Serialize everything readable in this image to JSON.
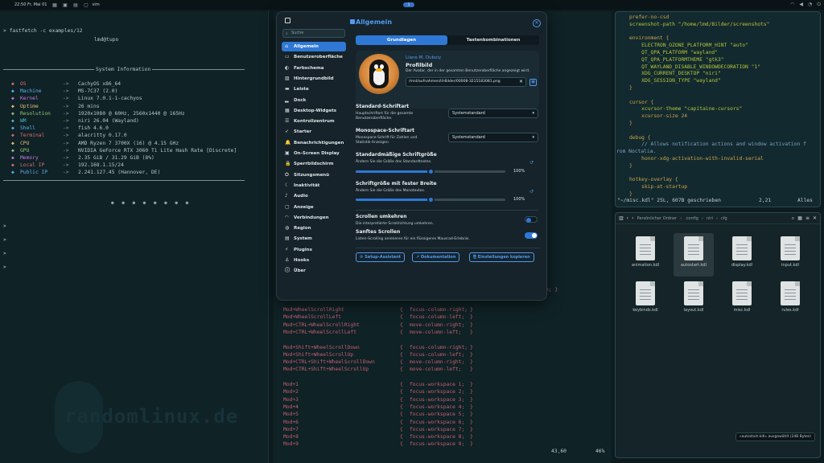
{
  "topbar": {
    "clock": "22:50 Fr, Mai 01",
    "workspace": "1",
    "app": "vim"
  },
  "fastfetch": {
    "prompt": "fastfetch -c examples/12",
    "userhost": "lmd@tupo",
    "header": "System Information",
    "rows": [
      {
        "key": "OS",
        "val": "CachyOS x86_64"
      },
      {
        "key": "Machine",
        "val": "MS-7C37 (2.0)"
      },
      {
        "key": "Kernel",
        "val": "Linux 7.0.1-1-cachyos"
      },
      {
        "key": "Uptime",
        "val": "26 mins"
      },
      {
        "key": "Resolution",
        "val": "1920x1080 @ 60Hz, 2560x1440 @ 165Hz"
      },
      {
        "key": "WM",
        "val": "niri 26.04 (Wayland)"
      },
      {
        "key": "Shell",
        "val": "fish 4.6.0"
      },
      {
        "key": "Terminal",
        "val": "alacritty 0.17.0"
      },
      {
        "key": "CPU",
        "val": "AMD Ryzen 7 3700X (16) @ 4.15 GHz"
      },
      {
        "key": "GPU",
        "val": "NVIDIA GeForce RTX 3060 Ti Lite Hash Rate [Discrete]"
      },
      {
        "key": "Memory",
        "val": "2.35 GiB / 31.29 GiB (8%)"
      },
      {
        "key": "Local IP",
        "val": "192.168.1.15/24"
      },
      {
        "key": "Public IP",
        "val": "2.241.127.45 (Hannover, DE)"
      }
    ],
    "arrow": "->",
    "dots": "● ● ● ● ● ● ● ●",
    "prompt_glyph": ">",
    "watermark": "randomlinux.de"
  },
  "editor": {
    "lines": [
      "prefer-no-csd",
      "screenshot-path \"/home/lmd/Bilder/screenshots\"",
      "",
      "environment {",
      "    ELECTRON_OZONE_PLATFORM_HINT \"auto\"",
      "    QT_QPA_PLATFORM \"wayland\"",
      "    QT_QPA_PLATFORMTHEME \"gtk3\"",
      "    QT_WAYLAND_DISABLE_WINDOWDECORATION \"1\"",
      "    XDG_CURRENT_DESKTOP \"niri\"",
      "    XDG_SESSION_TYPE \"wayland\"",
      "}",
      "",
      "cursor {",
      "    xcursor-theme \"capitaine-cursors\"",
      "    xcursor-size 24",
      "}",
      "",
      "debug {",
      "    // Allows notification actions and window activation f",
      "rom Noctalia.",
      "    honor-xdg-activation-with-invalid-serial",
      "}",
      "",
      "hotkey-overlay {",
      "    skip-at-startup",
      "}"
    ],
    "status_file": "\"~/misc.kdl\" 25L, 607B geschrieben",
    "status_pos": "2,21",
    "status_all": "Alles"
  },
  "midterm": {
    "partial": "n; }",
    "binds": [
      {
        "key": "Mod+WheelScrollRight",
        "act": "focus-column-right;"
      },
      {
        "key": "Mod+WheelScrollLeft",
        "act": "focus-column-left;"
      },
      {
        "key": "Mod+CTRL+WheelScrollRight",
        "act": "move-column-right;"
      },
      {
        "key": "Mod+CTRL+WheelScrollLeft",
        "act": "move-column-left;"
      },
      {
        "key": "",
        "act": ""
      },
      {
        "key": "Mod+Shift+WheelScrollDown",
        "act": "focus-column-right;"
      },
      {
        "key": "Mod+Shift+WheelScrollUp",
        "act": "focus-column-left;"
      },
      {
        "key": "Mod+CTRL+Shift+WheelScrollDown",
        "act": "move-column-right;"
      },
      {
        "key": "Mod+CTRL+Shift+WheelScrollUp",
        "act": "move-column-left;"
      },
      {
        "key": "",
        "act": ""
      },
      {
        "key": "Mod+1",
        "act": "focus-workspace 1;"
      },
      {
        "key": "Mod+2",
        "act": "focus-workspace 2;"
      },
      {
        "key": "Mod+3",
        "act": "focus-workspace 3;"
      },
      {
        "key": "Mod+4",
        "act": "focus-workspace 4;"
      },
      {
        "key": "Mod+5",
        "act": "focus-workspace 5;"
      },
      {
        "key": "Mod+6",
        "act": "focus-workspace 6;"
      },
      {
        "key": "Mod+7",
        "act": "focus-workspace 7;"
      },
      {
        "key": "Mod+8",
        "act": "focus-workspace 8;"
      },
      {
        "key": "Mod+9",
        "act": "focus-workspace 9;"
      }
    ],
    "status_pos": "43,60",
    "status_pct": "46%"
  },
  "filemanager": {
    "crumbs": [
      "Persönlicher Ordner",
      ".config",
      "niri",
      "cfg"
    ],
    "files": [
      "animation.kdl",
      "autostart.kdl",
      "display.kdl",
      "input.kdl",
      "keybinds.kdl",
      "layout.kdl",
      "misc.kdl",
      "rules.kdl"
    ],
    "selected": "autostart.kdl",
    "status": "»autostart.kdl« ausgewählt (248 Bytes)"
  },
  "settings": {
    "search_placeholder": "Suche",
    "nav": [
      "Allgemein",
      "Benutzeroberfläche",
      "Farbschema",
      "Hintergrundbild",
      "Leiste",
      "Dock",
      "Desktop-Widgets",
      "Kontrollzentrum",
      "Starter",
      "Benachrichtigungen",
      "On-Screen Display",
      "Sperrbildschirm",
      "Sitzungsmenü",
      "Inaktivität",
      "Audio",
      "Anzeige",
      "Verbindungen",
      "Region",
      "System",
      "Plugins",
      "Hooks",
      "Über"
    ],
    "nav_icons": [
      "home-icon",
      "layout-icon",
      "palette-icon",
      "image-icon",
      "bar-icon",
      "dock-icon",
      "widgets-icon",
      "control-icon",
      "rocket-icon",
      "bell-icon",
      "display-icon",
      "lock-icon",
      "power-icon",
      "moon-icon",
      "speaker-icon",
      "monitor-icon",
      "wifi-icon",
      "globe-icon",
      "cpu-icon",
      "plug-icon",
      "hook-icon",
      "info-icon"
    ],
    "title": "Allgemein",
    "tabs": [
      "Grundlagen",
      "Tastenkombinationen"
    ],
    "profile": {
      "name": "Liane M. Duboiy",
      "label": "Profilbild",
      "desc": "Der Avatar, der in der gesamten Benutzeroberfläche angezeigt wird.",
      "path": "/mnt/aufnahmen/lil-Bilder/00008-3215183081.png"
    },
    "font_std": {
      "label": "Standard-Schriftart",
      "desc1": "Hauptschriftart für die gesamte",
      "desc2": "Benutzeroberfläche.",
      "value": "Systemstandard"
    },
    "font_mono": {
      "label": "Monospace-Schriftart",
      "desc1": "Monospace-Schrift für Zahlen und",
      "desc2": "Statistik-Anzeigen.",
      "value": "Systemstandard"
    },
    "size_std": {
      "label": "Standardmäßige Schriftgröße",
      "desc": "Ändern Sie die Größe des Standardtextes.",
      "value": "100%",
      "level": 0.5
    },
    "size_mono": {
      "label": "Schriftgröße mit fester Breite",
      "desc": "Ändern Sie die Größe des Monotextes.",
      "value": "100%",
      "level": 0.5
    },
    "scroll_rev": {
      "label": "Scrollen umkehren",
      "desc": "Die interpretierte Scrollrichtung umkehren.",
      "on": false
    },
    "smooth": {
      "label": "Sanftes Scrollen",
      "desc": "Listen-Scrolling animieren für ein flüssigeres Mausrad-Erlebnis.",
      "on": true
    },
    "buttons": [
      "Setup-Assistent",
      "Dokumentation",
      "Einstellungen kopieren"
    ],
    "accent": "#2f78d6"
  }
}
